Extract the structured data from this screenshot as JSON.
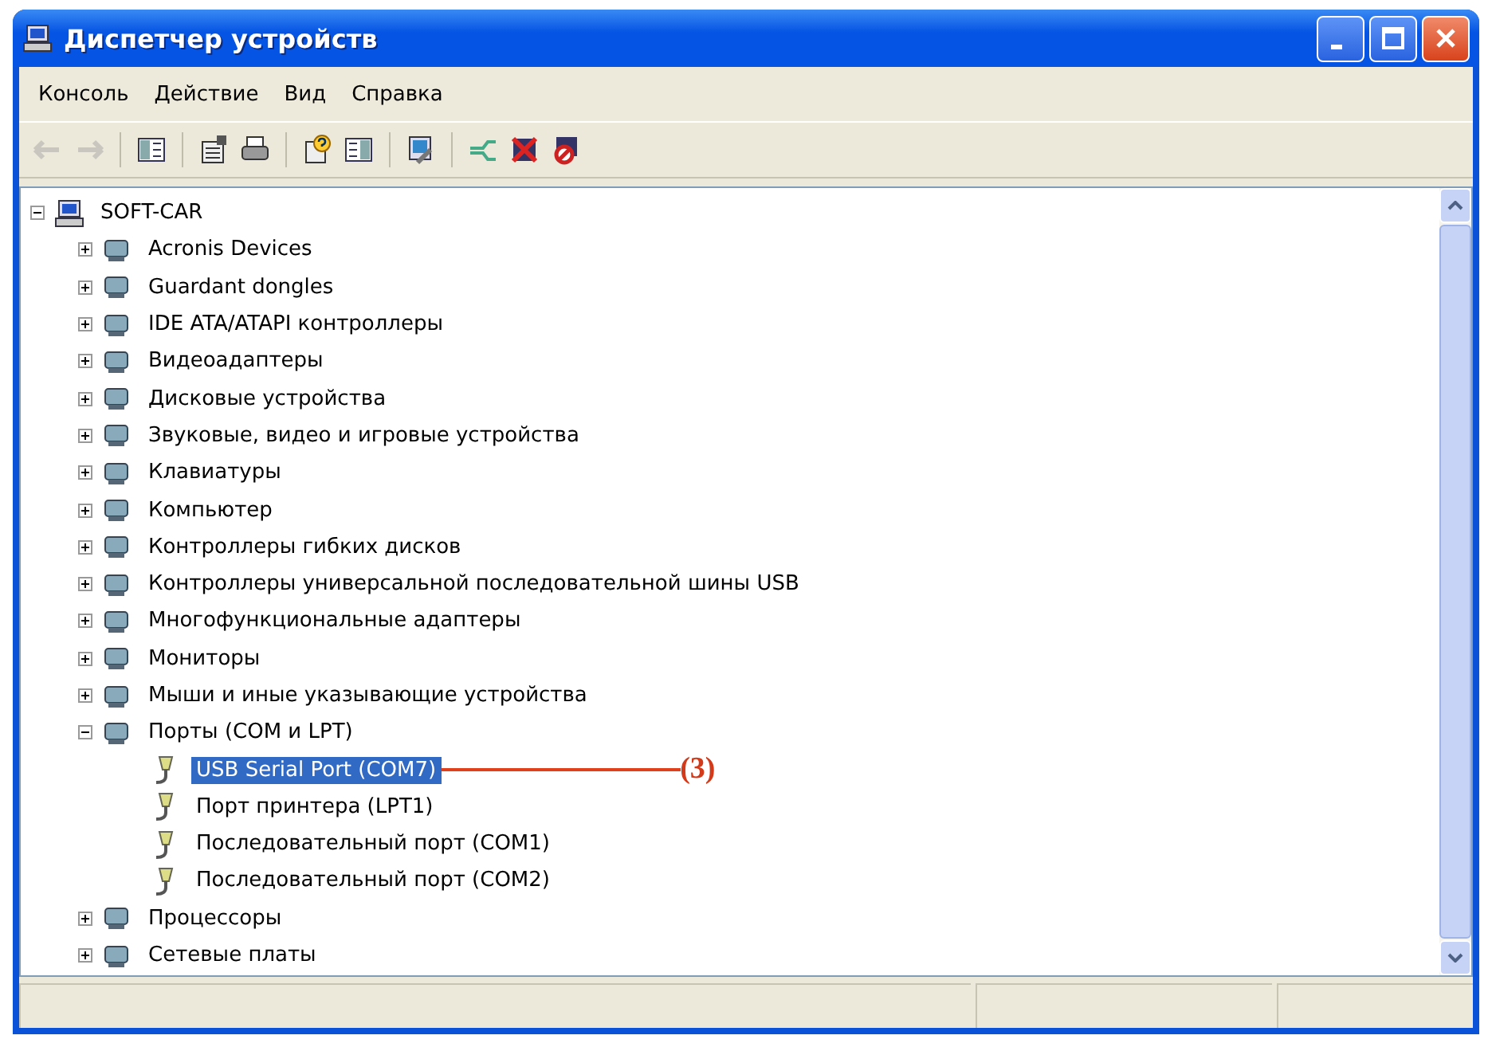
{
  "window": {
    "title": "Диспетчер устройств"
  },
  "menu": [
    {
      "label": "Консоль"
    },
    {
      "label": "Действие"
    },
    {
      "label": "Вид"
    },
    {
      "label": "Справка"
    }
  ],
  "toolbar": [
    {
      "kind": "back",
      "disabled": true
    },
    {
      "kind": "forward",
      "disabled": true
    },
    {
      "kind": "sep"
    },
    {
      "kind": "tree",
      "disabled": false
    },
    {
      "kind": "sep"
    },
    {
      "kind": "properties",
      "disabled": false
    },
    {
      "kind": "print",
      "disabled": false
    },
    {
      "kind": "sep"
    },
    {
      "kind": "help",
      "disabled": false
    },
    {
      "kind": "pane",
      "disabled": false
    },
    {
      "kind": "sep"
    },
    {
      "kind": "scan",
      "disabled": false
    },
    {
      "kind": "sep"
    },
    {
      "kind": "update",
      "disabled": false
    },
    {
      "kind": "uninstall",
      "disabled": false
    },
    {
      "kind": "disable",
      "disabled": false
    }
  ],
  "tree": {
    "label": "SOFT-CAR",
    "expanded": true,
    "selected": false,
    "children": [
      {
        "label": "Acronis Devices",
        "expanded": false,
        "selected": false
      },
      {
        "label": "Guardant dongles",
        "expanded": false,
        "selected": false
      },
      {
        "label": "IDE ATA/ATAPI контроллеры",
        "expanded": false,
        "selected": false
      },
      {
        "label": "Видеоадаптеры",
        "expanded": false,
        "selected": false
      },
      {
        "label": "Дисковые устройства",
        "expanded": false,
        "selected": false
      },
      {
        "label": "Звуковые, видео и игровые устройства",
        "expanded": false,
        "selected": false
      },
      {
        "label": "Клавиатуры",
        "expanded": false,
        "selected": false
      },
      {
        "label": "Компьютер",
        "expanded": false,
        "selected": false
      },
      {
        "label": "Контроллеры гибких дисков",
        "expanded": false,
        "selected": false
      },
      {
        "label": "Контроллеры универсальной последовательной шины USB",
        "expanded": false,
        "selected": false
      },
      {
        "label": "Многофункциональные адаптеры",
        "expanded": false,
        "selected": false
      },
      {
        "label": "Мониторы",
        "expanded": false,
        "selected": false
      },
      {
        "label": "Мыши и иные указывающие устройства",
        "expanded": false,
        "selected": false
      },
      {
        "label": "Порты (COM и LPT)",
        "expanded": true,
        "selected": false,
        "children": [
          {
            "label": "USB Serial Port (COM7)",
            "selected": true,
            "annotation": "(3)"
          },
          {
            "label": "Порт принтера (LPT1)",
            "selected": false
          },
          {
            "label": "Последовательный порт (COM1)",
            "selected": false
          },
          {
            "label": "Последовательный порт (COM2)",
            "selected": false
          }
        ]
      },
      {
        "label": "Процессоры",
        "expanded": false,
        "selected": false
      },
      {
        "label": "Сетевые платы",
        "expanded": false,
        "selected": false
      }
    ]
  }
}
